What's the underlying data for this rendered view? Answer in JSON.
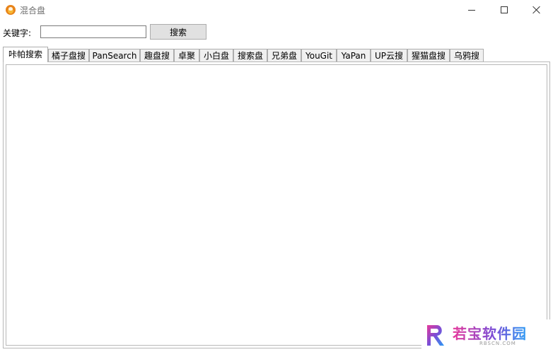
{
  "window": {
    "title": "混合盘"
  },
  "search": {
    "label": "关键字:",
    "value": "",
    "placeholder": "",
    "button_label": "搜索"
  },
  "tabs": [
    {
      "label": "咔帕搜索",
      "active": true
    },
    {
      "label": "橘子盘搜",
      "active": false
    },
    {
      "label": "PanSearch",
      "active": false
    },
    {
      "label": "趣盘搜",
      "active": false
    },
    {
      "label": "卓聚",
      "active": false
    },
    {
      "label": "小白盘",
      "active": false
    },
    {
      "label": "搜索盘",
      "active": false
    },
    {
      "label": "兄弟盘",
      "active": false
    },
    {
      "label": "YouGit",
      "active": false
    },
    {
      "label": "YaPan",
      "active": false
    },
    {
      "label": "UP云搜",
      "active": false
    },
    {
      "label": "猩猫盘搜",
      "active": false
    },
    {
      "label": "乌鸦搜",
      "active": false
    }
  ],
  "watermark": {
    "text": "若宝软件园",
    "subtext": "RBSCN.COM"
  },
  "colors": {
    "watermark_gradient_start": "#e6399b",
    "watermark_gradient_end": "#2b9bf4",
    "app_icon": "#f7b733"
  }
}
